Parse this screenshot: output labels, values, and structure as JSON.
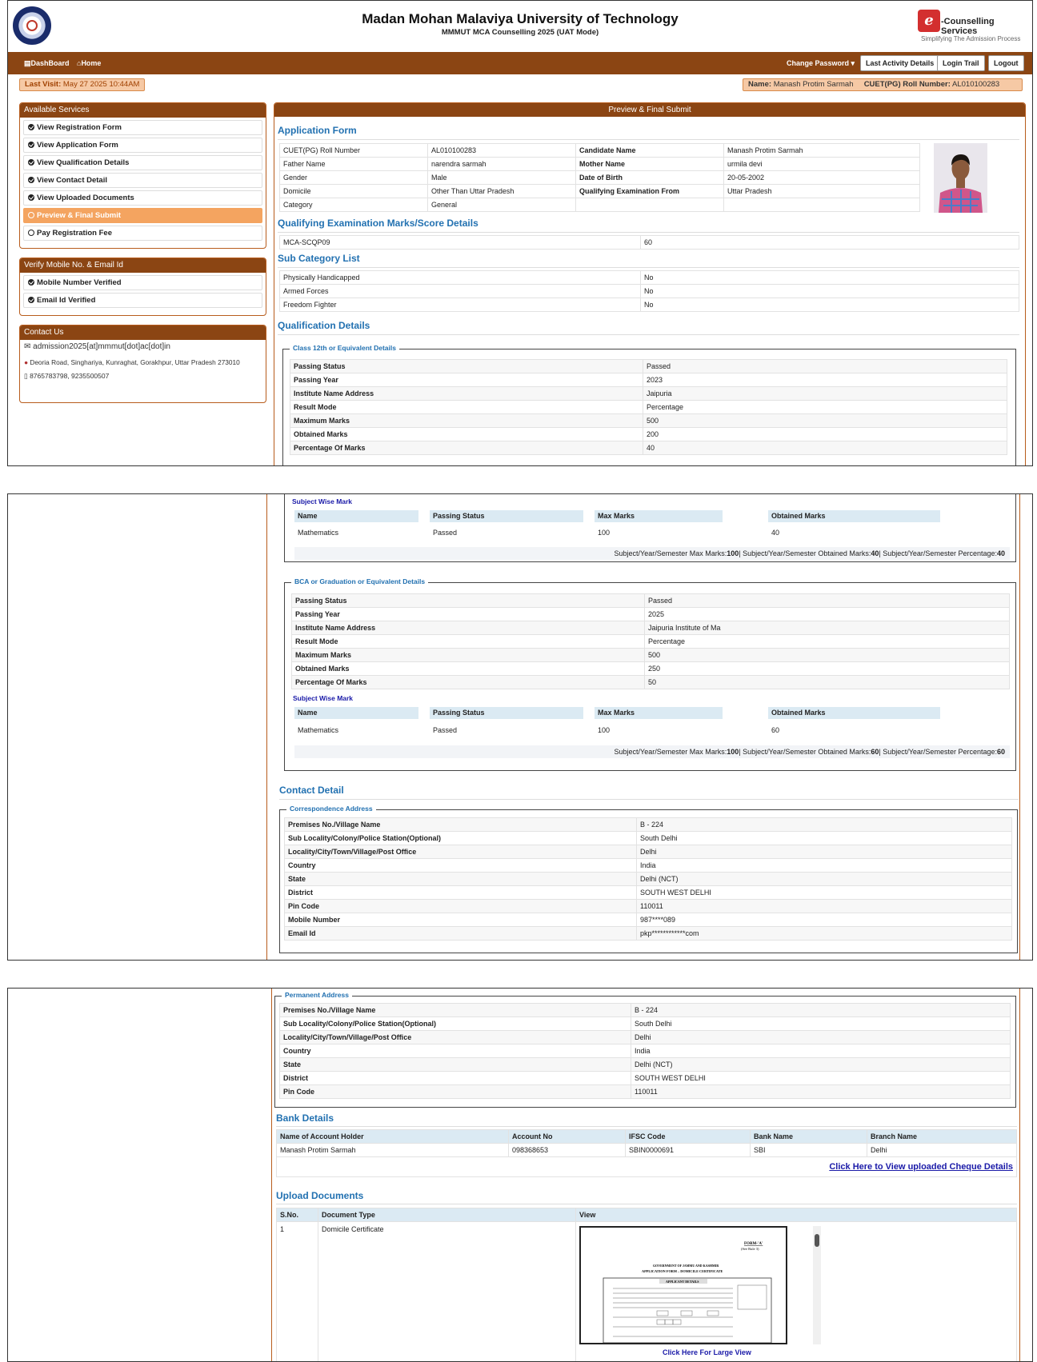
{
  "header": {
    "title": "Madan Mohan Malaviya University of Technology",
    "subtitle": "MMMUT MCA Counselling 2025 (UAT Mode)",
    "brand_letter": "e",
    "brand_title": "-Counselling Services",
    "brand_tagline": "Simplifying The Admission Process"
  },
  "nav": {
    "dashboard": "DashBoard",
    "home": "Home",
    "change_password": "Change Password",
    "last_activity": "Last Activity Details",
    "login_trail": "Login Trail",
    "logout": "Logout"
  },
  "status": {
    "last_visit_label": "Last Visit:",
    "last_visit_value": "May 27 2025 10:44AM",
    "name_label": "Name:",
    "name_value": "Manash Protim Sarmah",
    "roll_label": "CUET(PG) Roll Number:",
    "roll_value": "AL010100283"
  },
  "sidebar": {
    "services_title": "Available Services",
    "services": [
      {
        "label": "View Registration Form",
        "icon": "check-circle-icon"
      },
      {
        "label": "View Application Form",
        "icon": "check-circle-icon"
      },
      {
        "label": "View Qualification Details",
        "icon": "check-circle-icon"
      },
      {
        "label": "View Contact Detail",
        "icon": "check-circle-icon"
      },
      {
        "label": "View Uploaded Documents",
        "icon": "check-circle-icon"
      },
      {
        "label": "Preview & Final Submit",
        "icon": "clock-icon",
        "active": true
      },
      {
        "label": "Pay Registration Fee",
        "icon": "clock-icon"
      }
    ],
    "verify_title": "Verify Mobile No. & Email Id",
    "verify": [
      "Mobile Number Verified",
      "Email Id Verified"
    ],
    "contact_title": "Contact Us",
    "contact_email": "admission2025[at]mmmut[dot]ac[dot]in",
    "contact_address": "Deoria Road, Singhariya, Kunraghat, Gorakhpur, Uttar Pradesh 273010",
    "contact_phone": "8765783798, 9235500507"
  },
  "main": {
    "panel_title": "Preview & Final Submit",
    "application_form_title": "Application Form",
    "application_rows": [
      [
        "CUET(PG) Roll Number",
        "AL010100283",
        "Candidate Name",
        "Manash Protim Sarmah"
      ],
      [
        "Father Name",
        "narendra sarmah",
        "Mother Name",
        "urmila devi"
      ],
      [
        "Gender",
        "Male",
        "Date of Birth",
        "20-05-2002"
      ],
      [
        "Domicile",
        "Other Than Uttar Pradesh",
        "Qualifying Examination From",
        "Uttar Pradesh"
      ],
      [
        "Category",
        "General",
        "",
        ""
      ]
    ],
    "qualifying_title": "Qualifying Examination Marks/Score Details",
    "qualifying_row": [
      "MCA-SCQP09",
      "60"
    ],
    "subcat_title": "Sub Category List",
    "subcat_rows": [
      [
        "Physically Handicapped",
        "No"
      ],
      [
        "Armed Forces",
        "No"
      ],
      [
        "Freedom Fighter",
        "No"
      ]
    ],
    "qualification_title": "Qualification Details",
    "class12": {
      "legend": "Class 12th or Equivalent Details",
      "rows": [
        [
          "Passing Status",
          "Passed"
        ],
        [
          "Passing Year",
          "2023"
        ],
        [
          "Institute Name Address",
          "Jaipuria"
        ],
        [
          "Result Mode",
          "Percentage"
        ],
        [
          "Maximum Marks",
          "500"
        ],
        [
          "Obtained Marks",
          "200"
        ],
        [
          "Percentage Of Marks",
          "40"
        ]
      ],
      "subject_title": "Subject Wise Mark",
      "subject_headers": [
        "Name",
        "Passing Status",
        "Max Marks",
        "Obtained Marks"
      ],
      "subject_row": [
        "Mathematics",
        "Passed",
        "100",
        "40"
      ],
      "summary": {
        "max_label": "Subject/Year/Semester Max Marks:",
        "max": "100",
        "obt_label": "| Subject/Year/Semester Obtained Marks:",
        "obt": "40",
        "pct_label": "| Subject/Year/Semester Percentage:",
        "pct": "40"
      }
    },
    "graduation": {
      "legend": "BCA or Graduation or Equivalent Details",
      "rows": [
        [
          "Passing Status",
          "Passed"
        ],
        [
          "Passing Year",
          "2025"
        ],
        [
          "Institute Name Address",
          "Jaipuria Institute of Ma"
        ],
        [
          "Result Mode",
          "Percentage"
        ],
        [
          "Maximum Marks",
          "500"
        ],
        [
          "Obtained Marks",
          "250"
        ],
        [
          "Percentage Of Marks",
          "50"
        ]
      ],
      "subject_title": "Subject Wise Mark",
      "subject_headers": [
        "Name",
        "Passing Status",
        "Max Marks",
        "Obtained Marks"
      ],
      "subject_row": [
        "Mathematics",
        "Passed",
        "100",
        "60"
      ],
      "summary": {
        "max_label": "Subject/Year/Semester Max Marks:",
        "max": "100",
        "obt_label": "| Subject/Year/Semester Obtained Marks:",
        "obt": "60",
        "pct_label": "| Subject/Year/Semester Percentage:",
        "pct": "60"
      }
    },
    "contact_title": "Contact Detail",
    "correspondence": {
      "legend": "Correspondence Address",
      "rows": [
        [
          "Premises No./Village Name",
          "B - 224"
        ],
        [
          "Sub Locality/Colony/Police Station(Optional)",
          "South Delhi"
        ],
        [
          "Locality/City/Town/Village/Post Office",
          "Delhi"
        ],
        [
          "Country",
          "India"
        ],
        [
          "State",
          "Delhi (NCT)"
        ],
        [
          "District",
          "SOUTH WEST DELHI"
        ],
        [
          "Pin Code",
          "110011"
        ],
        [
          "Mobile Number",
          "987****089"
        ],
        [
          "Email Id",
          "pkp************com"
        ]
      ]
    },
    "permanent": {
      "legend": "Permanent Address",
      "rows": [
        [
          "Premises No./Village Name",
          "B - 224"
        ],
        [
          "Sub Locality/Colony/Police Station(Optional)",
          "South Delhi"
        ],
        [
          "Locality/City/Town/Village/Post Office",
          "Delhi"
        ],
        [
          "Country",
          "India"
        ],
        [
          "State",
          "Delhi (NCT)"
        ],
        [
          "District",
          "SOUTH WEST DELHI"
        ],
        [
          "Pin Code",
          "110011"
        ]
      ]
    },
    "bank": {
      "title": "Bank Details",
      "headers": [
        "Name of Account Holder",
        "Account No",
        "IFSC Code",
        "Bank Name",
        "Branch Name"
      ],
      "row": [
        "Manash Protim Sarmah",
        "098368653",
        "SBIN0000691",
        "SBI",
        "Delhi"
      ],
      "cheque_link": "Click Here to View uploaded Cheque Details"
    },
    "documents": {
      "title": "Upload Documents",
      "headers": [
        "S.No.",
        "Document Type",
        "View"
      ],
      "row": [
        "1",
        "Domicile Certificate"
      ],
      "large_view_link": "Click Here For Large View",
      "preview": {
        "form_label": "FORM-'A'",
        "rule": "(See Rule 3)",
        "gov": "GOVERNMENT OF JAMMU AND KASHMIR",
        "form_title": "APPLICATION FORM – DOMICILE CERTIFICATE",
        "applicant": "APPLICANT DETAILS"
      }
    }
  }
}
